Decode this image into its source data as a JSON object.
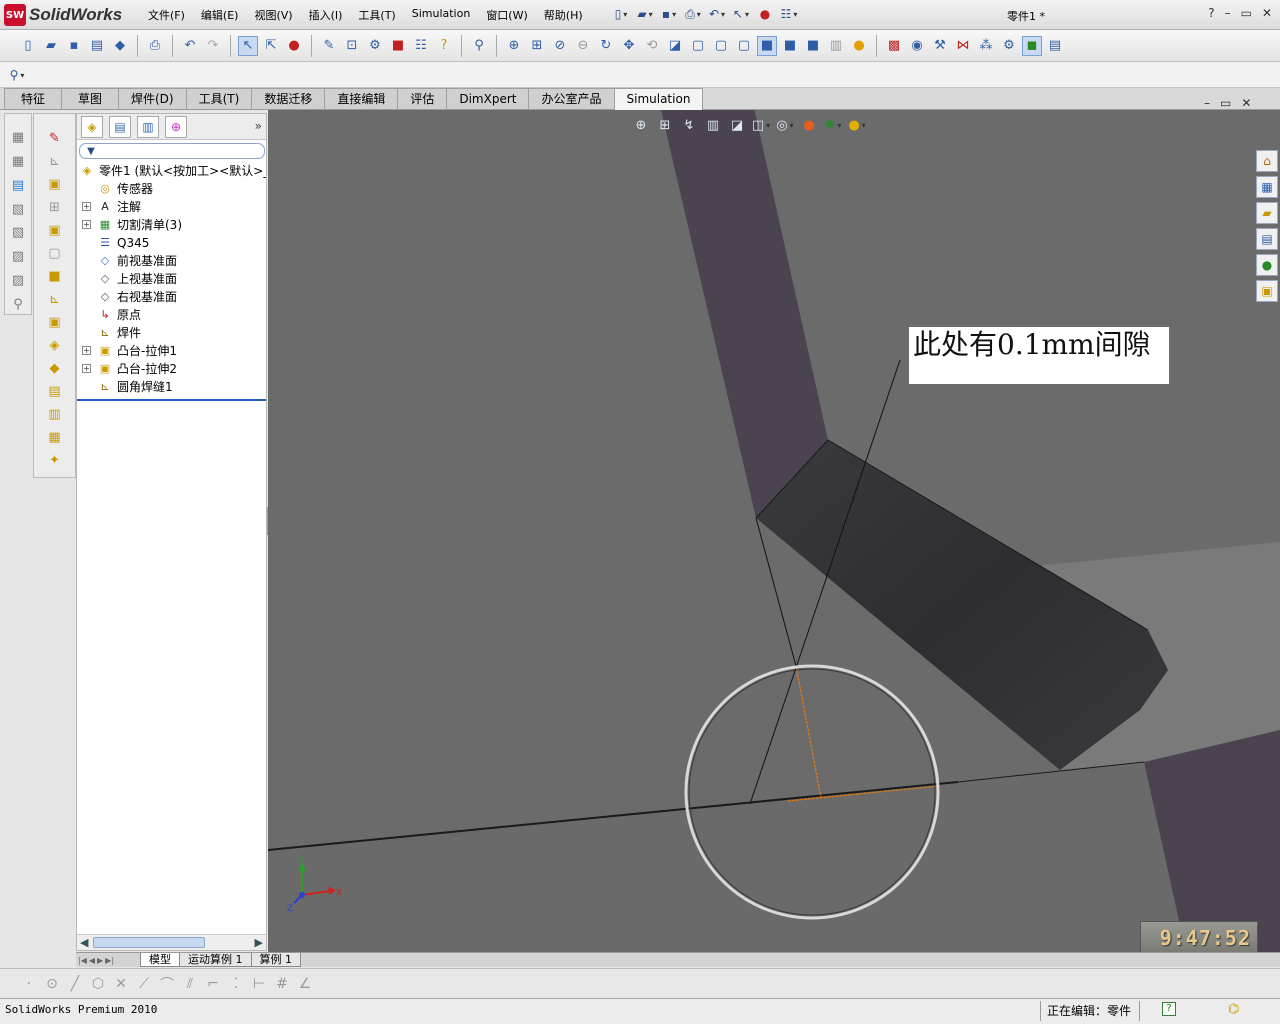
{
  "app": {
    "logo_text": "SolidWorks",
    "logo_badge": "SW",
    "document_title": "零件1 *"
  },
  "menu": [
    "文件(F)",
    "编辑(E)",
    "视图(V)",
    "插入(I)",
    "工具(T)",
    "Simulation",
    "窗口(W)",
    "帮助(H)"
  ],
  "window_controls": {
    "help": "?",
    "minimize": "–",
    "restore": "▭",
    "close": "✕"
  },
  "command_tabs": [
    {
      "label": "特征",
      "active": false
    },
    {
      "label": "草图",
      "active": false
    },
    {
      "label": "焊件(D)",
      "active": false
    },
    {
      "label": "工具(T)",
      "active": false
    },
    {
      "label": "数据迁移",
      "active": false
    },
    {
      "label": "直接编辑",
      "active": false
    },
    {
      "label": "评估",
      "active": false
    },
    {
      "label": "DimXpert",
      "active": false
    },
    {
      "label": "办公室产品",
      "active": false
    },
    {
      "label": "Simulation",
      "active": true
    }
  ],
  "feature_tree": {
    "more_label": "»",
    "items": [
      {
        "label": "零件1  (默认<按加工><默认>_",
        "icon": "part-icon",
        "glyph": "◈",
        "color": "#c99a00",
        "expand": "",
        "indent": 0
      },
      {
        "label": "传感器",
        "icon": "sensor-icon",
        "glyph": "◎",
        "color": "#c99a00",
        "expand": "",
        "indent": 1
      },
      {
        "label": "注解",
        "icon": "annotation-icon",
        "glyph": "A",
        "color": "#222222",
        "expand": "+",
        "indent": 1
      },
      {
        "label": "切割清单(3)",
        "icon": "cut-list-icon",
        "glyph": "▦",
        "color": "#2a8a2a",
        "expand": "+",
        "indent": 1
      },
      {
        "label": "Q345",
        "icon": "material-icon",
        "glyph": "☰",
        "color": "#3355aa",
        "expand": "",
        "indent": 1
      },
      {
        "label": "前视基准面",
        "icon": "plane-icon",
        "glyph": "◇",
        "color": "#2a7ad0",
        "expand": "",
        "indent": 1
      },
      {
        "label": "上视基准面",
        "icon": "plane-icon",
        "glyph": "◇",
        "color": "#555555",
        "expand": "",
        "indent": 1
      },
      {
        "label": "右视基准面",
        "icon": "plane-icon",
        "glyph": "◇",
        "color": "#555555",
        "expand": "",
        "indent": 1
      },
      {
        "label": "原点",
        "icon": "origin-icon",
        "glyph": "↳",
        "color": "#c02020",
        "expand": "",
        "indent": 1
      },
      {
        "label": "焊件",
        "icon": "weldment-icon",
        "glyph": "⊾",
        "color": "#8a6a00",
        "expand": "",
        "indent": 1
      },
      {
        "label": "凸台-拉伸1",
        "icon": "boss-extrude-icon",
        "glyph": "▣",
        "color": "#c99a00",
        "expand": "+",
        "indent": 1
      },
      {
        "label": "凸台-拉伸2",
        "icon": "boss-extrude-icon",
        "glyph": "▣",
        "color": "#c99a00",
        "expand": "+",
        "indent": 1
      },
      {
        "label": "圆角焊缝1",
        "icon": "fillet-bead-icon",
        "glyph": "⊾",
        "color": "#8a6a00",
        "expand": "",
        "indent": 1
      }
    ]
  },
  "viewport": {
    "annotation": "此处有0.1mm间隙",
    "timer": "9:47:52",
    "triad": {
      "x": "X",
      "y": "Y",
      "z": "Z"
    },
    "colors": {
      "background": "#6b6b6b",
      "tube": "#4a4350",
      "highlight": "#e07a10"
    }
  },
  "bottom_tabs": [
    {
      "label": "模型",
      "active": true
    },
    {
      "label": "运动算例 1",
      "active": false
    },
    {
      "label": "算例 1",
      "active": false
    }
  ],
  "status": {
    "product": "SolidWorks Premium 2010",
    "editing": "正在编辑：零件",
    "help_badge": "?"
  }
}
